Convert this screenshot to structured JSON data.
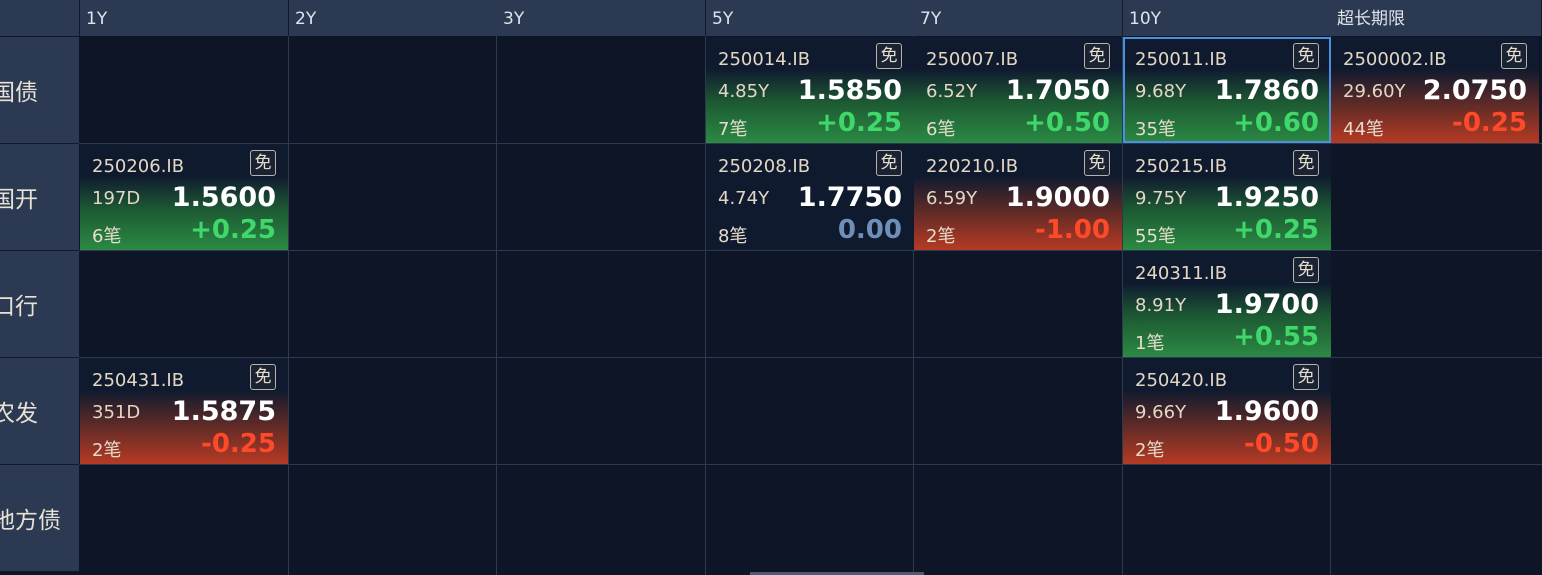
{
  "columns": [
    "1Y",
    "2Y",
    "3Y",
    "5Y",
    "7Y",
    "10Y",
    "超长期限"
  ],
  "rows": [
    "国债",
    "国开",
    "口行",
    "农发",
    "地方债"
  ],
  "cells": [
    {
      "row": 0,
      "col": 3,
      "code": "250014.IB",
      "badge": "免",
      "term": "4.85Y",
      "yield": "1.5850",
      "trades": "7笔",
      "change": "+0.25",
      "trend": "up"
    },
    {
      "row": 0,
      "col": 4,
      "code": "250007.IB",
      "badge": "免",
      "term": "6.52Y",
      "yield": "1.7050",
      "trades": "6笔",
      "change": "+0.50",
      "trend": "up"
    },
    {
      "row": 0,
      "col": 5,
      "code": "250011.IB",
      "badge": "免",
      "term": "9.68Y",
      "yield": "1.7860",
      "trades": "35笔",
      "change": "+0.60",
      "trend": "up",
      "selected": true
    },
    {
      "row": 0,
      "col": 6,
      "code": "2500002.IB",
      "badge": "免",
      "term": "29.60Y",
      "yield": "2.0750",
      "trades": "44笔",
      "change": "-0.25",
      "trend": "down"
    },
    {
      "row": 1,
      "col": 0,
      "code": "250206.IB",
      "badge": "免",
      "term": "197D",
      "yield": "1.5600",
      "trades": "6笔",
      "change": "+0.25",
      "trend": "up"
    },
    {
      "row": 1,
      "col": 3,
      "code": "250208.IB",
      "badge": "免",
      "term": "4.74Y",
      "yield": "1.7750",
      "trades": "8笔",
      "change": "0.00",
      "trend": "zero"
    },
    {
      "row": 1,
      "col": 4,
      "code": "220210.IB",
      "badge": "免",
      "term": "6.59Y",
      "yield": "1.9000",
      "trades": "2笔",
      "change": "-1.00",
      "trend": "down"
    },
    {
      "row": 1,
      "col": 5,
      "code": "250215.IB",
      "badge": "免",
      "term": "9.75Y",
      "yield": "1.9250",
      "trades": "55笔",
      "change": "+0.25",
      "trend": "up"
    },
    {
      "row": 2,
      "col": 5,
      "code": "240311.IB",
      "badge": "免",
      "term": "8.91Y",
      "yield": "1.9700",
      "trades": "1笔",
      "change": "+0.55",
      "trend": "up"
    },
    {
      "row": 3,
      "col": 0,
      "code": "250431.IB",
      "badge": "免",
      "term": "351D",
      "yield": "1.5875",
      "trades": "2笔",
      "change": "-0.25",
      "trend": "down"
    },
    {
      "row": 3,
      "col": 5,
      "code": "250420.IB",
      "badge": "免",
      "term": "9.66Y",
      "yield": "1.9600",
      "trades": "2笔",
      "change": "-0.50",
      "trend": "down"
    }
  ],
  "colors": {
    "up": "#40d86a",
    "down": "#ff4a2a",
    "zero": "#6f8fb8",
    "selected_border": "#4b8fe0"
  }
}
